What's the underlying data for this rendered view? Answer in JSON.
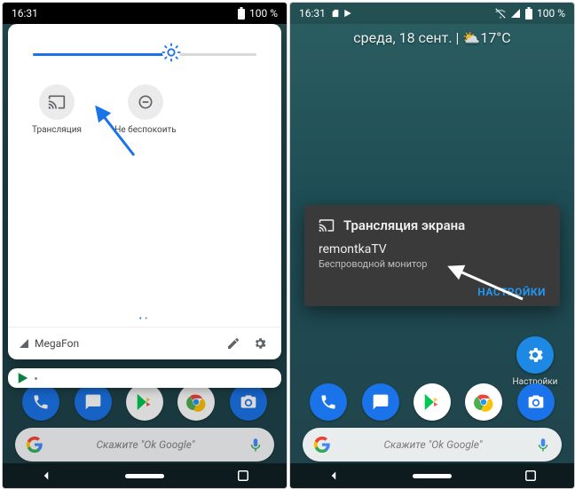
{
  "left": {
    "status": {
      "time": "16:31",
      "battery": "100 %"
    },
    "brightness": {
      "percent": 62
    },
    "tiles": {
      "cast": {
        "label": "Трансляция"
      },
      "dnd": {
        "label": "Не беспокоить"
      }
    },
    "carrier": "MegaFon",
    "search_hint": "Скажите \"Ok Google\""
  },
  "right": {
    "status": {
      "time": "16:31",
      "battery": "100 %"
    },
    "date_line": "среда, 18 сент.  |  ⛅17°C",
    "cast_dialog": {
      "title": "Трансляция экрана",
      "device": "remontkaTV",
      "subtitle": "Беспроводной монитор",
      "settings": "НАСТРОЙКИ"
    },
    "settings_shortcut": "Настройки",
    "search_hint": "Скажите \"Ok Google\""
  }
}
